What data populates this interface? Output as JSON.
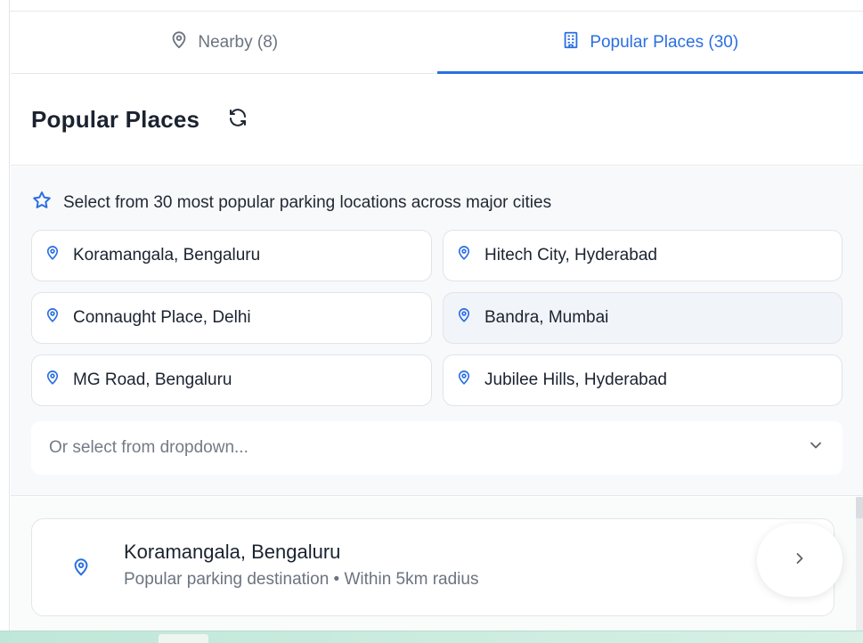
{
  "tabs": {
    "nearby_label": "Nearby (8)",
    "popular_label": "Popular Places (30)"
  },
  "header": {
    "title": "Popular Places"
  },
  "hint": {
    "text": "Select from 30 most popular parking locations across major cities"
  },
  "places": [
    {
      "label": "Koramangala, Bengaluru"
    },
    {
      "label": "Hitech City, Hyderabad"
    },
    {
      "label": "Connaught Place, Delhi"
    },
    {
      "label": "Bandra, Mumbai"
    },
    {
      "label": "MG Road, Bengaluru"
    },
    {
      "label": "Jubilee Hills, Hyderabad"
    }
  ],
  "dropdown": {
    "placeholder": "Or select from dropdown..."
  },
  "result": {
    "title": "Koramangala, Bengaluru",
    "subtitle": "Popular parking destination • Within 5km radius"
  },
  "colors": {
    "accent": "#2b6fe0",
    "text_primary": "#1b2330",
    "text_muted": "#6b7480",
    "border": "#e1e4e8"
  },
  "icons": {
    "nearby_tab": "map-pin-icon",
    "popular_tab": "building-icon",
    "refresh": "refresh-icon",
    "hint": "star-icon",
    "place": "map-pin-icon",
    "dropdown": "chevron-down-icon",
    "next": "chevron-right-icon"
  }
}
